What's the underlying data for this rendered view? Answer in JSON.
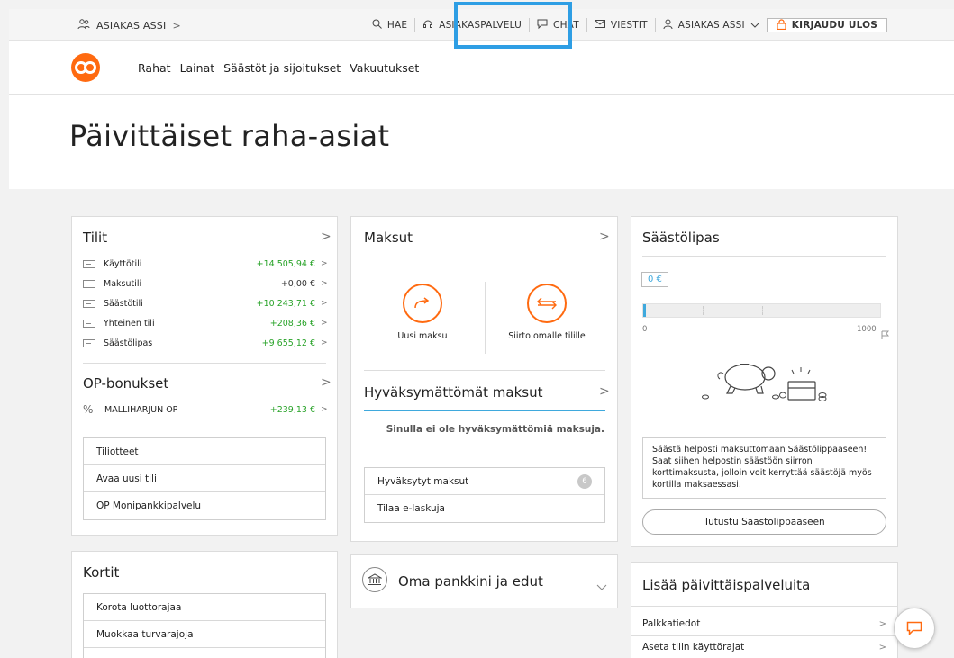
{
  "topbar": {
    "user_left": "ASIAKAS ASSI",
    "search": "HAE",
    "customer_service": "ASIAKASPALVELU",
    "chat": "CHAT",
    "messages": "VIESTIT",
    "user_right": "ASIAKAS ASSI",
    "logout": "KIRJAUDU ULOS"
  },
  "nav": {
    "items": [
      "Rahat",
      "Lainat",
      "Säästöt ja sijoitukset",
      "Vakuutukset"
    ]
  },
  "page_title": "Päivittäiset raha-asiat",
  "accounts": {
    "title": "Tilit",
    "items": [
      {
        "name": "Käyttötili",
        "amount": "+14 505,94 €"
      },
      {
        "name": "Maksutili",
        "amount": "+0,00 €"
      },
      {
        "name": "Säästötili",
        "amount": "+10 243,71 €"
      },
      {
        "name": "Yhteinen tili",
        "amount": "+208,36 €"
      },
      {
        "name": "Säästölipas",
        "amount": "+9 655,12 €"
      }
    ],
    "bonus_title": "OP-bonukset",
    "bonus": {
      "icon": "%",
      "name": "MALLIHARJUN OP",
      "amount": "+239,13 €"
    },
    "links": [
      "Tiliotteet",
      "Avaa uusi tili",
      "OP Monipankkipalvelu"
    ]
  },
  "payments": {
    "title": "Maksut",
    "new_payment": "Uusi maksu",
    "own_transfer": "Siirto omalle tilille",
    "unapproved_title": "Hyväksymättömät maksut",
    "unapproved_empty": "Sinulla ei ole hyväksymättömiä maksuja.",
    "approved_label": "Hyväksytyt maksut",
    "approved_count": "6",
    "einvoice": "Tilaa e-laskuja"
  },
  "bank": {
    "title": "Oma pankkini ja edut"
  },
  "savings_box": {
    "title": "Säästölipas",
    "value": "0 €",
    "goal_fraction": 0,
    "min": "0",
    "max": "1000",
    "info": "Säästä helposti maksuttomaan Säästölippaaseen! Saat siihen helpostin säästöön siirron korttimaksusta, jolloin voit kerryttää säästöjä myös kortilla maksaessasi.",
    "cta": "Tutustu Säästölippaaseen"
  },
  "cards": {
    "title": "Kortit",
    "links": [
      "Korota luottorajaa",
      "Muokkaa turvarajoja",
      ""
    ]
  },
  "more": {
    "title": "Lisää päivittäispalveluita",
    "links": [
      "Palkkatiedot",
      "Aseta tilin käyttörajat"
    ]
  },
  "colors": {
    "accent": "#ff6a10",
    "positive": "#29a329",
    "highlight": "#2e9ee4"
  }
}
